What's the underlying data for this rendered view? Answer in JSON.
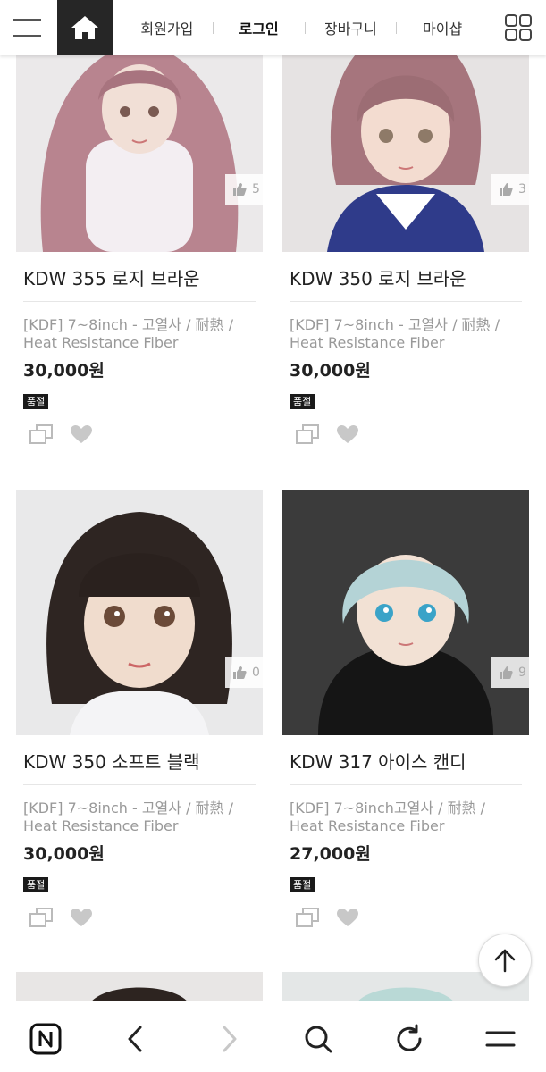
{
  "header": {
    "nav": [
      "회원가입",
      "로그인",
      "장바구니",
      "마이샵"
    ]
  },
  "products": [
    {
      "title": "KDW 355 로지 브라운",
      "desc_line1": "[KDF] 7~8inch - 고열사 / 耐熱 /",
      "desc_line2": "Heat Resistance Fiber",
      "price": "30,000원",
      "badge": "품절",
      "likes": "5",
      "hair": "#b8848f",
      "bg": "#eaeaea"
    },
    {
      "title": "KDW 350 로지 브라운",
      "desc_line1": "[KDF] 7~8inch - 고열사 / 耐熱 /",
      "desc_line2": "Heat Resistance Fiber",
      "price": "30,000원",
      "badge": "품절",
      "likes": "3",
      "hair": "#a6757d",
      "bg": "#e5e2e2"
    },
    {
      "title": "KDW 350 소프트 블랙",
      "desc_line1": "[KDF] 7~8inch - 고열사 / 耐熱 /",
      "desc_line2": "Heat Resistance Fiber",
      "price": "30,000원",
      "badge": "품절",
      "likes": "0",
      "hair": "#2e2522",
      "bg": "#e9e9ea"
    },
    {
      "title": "KDW 317 아이스 캔디",
      "desc_line1": "[KDF] 7~8inch고열사 / 耐熱 /",
      "desc_line2": "Heat Resistance Fiber",
      "price": "27,000원",
      "badge": "품절",
      "likes": "9",
      "hair": "#b4d3d6",
      "bg": "#3b3b3b"
    }
  ],
  "colors": {
    "header_dark": "#262626",
    "badge_bg": "#1a1a1a",
    "muted_text": "#999999"
  }
}
